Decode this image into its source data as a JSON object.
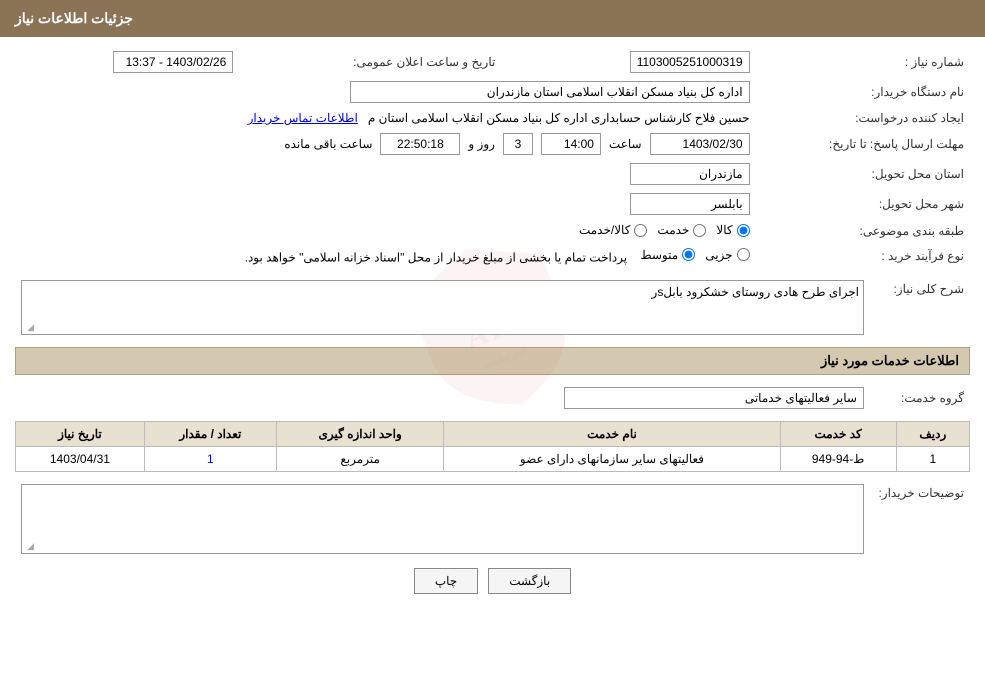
{
  "header": {
    "title": "جزئیات اطلاعات نیاز"
  },
  "fields": {
    "shomareNiaz_label": "شماره نیاز :",
    "shomareNiaz_value": "1103005251000319",
    "namDasgah_label": "نام دستگاه خریدار:",
    "namDasgah_value": "اداره کل بنیاد مسکن انقلاب اسلامی استان مازندران",
    "date_label": "تاریخ و ساعت اعلان عمومی:",
    "date_value": "1403/02/26 - 13:37",
    "creator_label": "ایجاد کننده درخواست:",
    "creator_value": "حسین فلاح کارشناس حسابداری اداره کل بنیاد مسکن انقلاب اسلامی استان م",
    "contact_link": "اطلاعات تماس خریدار",
    "deadline_label": "مهلت ارسال پاسخ: تا تاریخ:",
    "deadline_date": "1403/02/30",
    "deadline_time": "14:00",
    "deadline_day": "3",
    "deadline_remaining": "22:50:18",
    "deadline_unit": "ساعت باقی مانده",
    "deadline_day_label": "روز و",
    "deadline_time_label": "ساعت",
    "province_label": "استان محل تحویل:",
    "province_value": "مازندران",
    "city_label": "شهر محل تحویل:",
    "city_value": "بابلسر",
    "classification_label": "طبقه بندی موضوعی:",
    "classification_kala": "کالا",
    "classification_khedmat": "خدمت",
    "classification_kala_khedmat": "کالا/خدمت",
    "purchase_type_label": "نوع فرآیند خرید :",
    "purchase_jozei": "جزیی",
    "purchase_motavaset": "متوسط",
    "purchase_desc": "پرداخت تمام یا بخشی از مبلغ خریدار از محل \"اسناد خزانه اسلامی\" خواهد بود.",
    "sharh_label": "شرح کلی نیاز:",
    "sharh_value": "اجرای طرح هادی روستای خشکرود بابلsر",
    "services_section": "اطلاعات خدمات مورد نیاز",
    "goroh_label": "گروه خدمت:",
    "goroh_value": "سایر فعالیتهای خدماتی",
    "table": {
      "headers": [
        "ردیف",
        "کد خدمت",
        "نام خدمت",
        "واحد اندازه گیری",
        "تعداد / مقدار",
        "تاریخ نیاز"
      ],
      "rows": [
        {
          "radif": "1",
          "code": "ط-94-949",
          "name": "فعالیتهای سایر سازمانهای دارای عضو",
          "unit": "مترمربع",
          "count": "1",
          "date": "1403/04/31"
        }
      ]
    },
    "buyer_notes_label": "توضیحات خریدار:",
    "buyer_notes_value": ""
  },
  "buttons": {
    "print": "چاپ",
    "back": "بازگشت"
  }
}
